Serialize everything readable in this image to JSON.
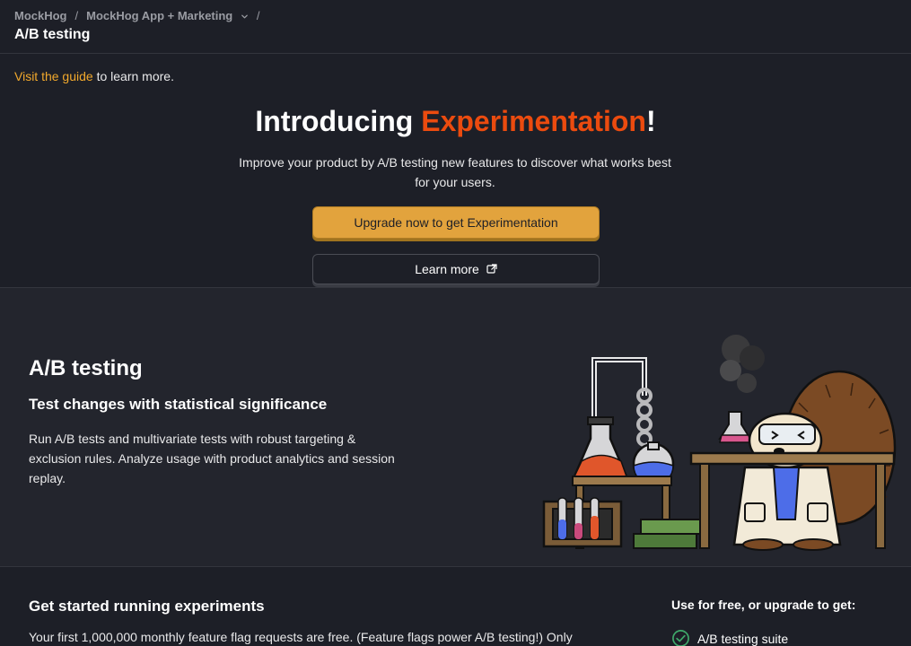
{
  "breadcrumb": {
    "org": "MockHog",
    "project": "MockHog App + Marketing",
    "separator": "/"
  },
  "page": {
    "title": "A/B testing"
  },
  "guide": {
    "link": "Visit the guide",
    "suffix": " to learn more."
  },
  "hero": {
    "title_prefix": "Introducing ",
    "title_accent": "Experimentation",
    "title_suffix": "!",
    "description": "Improve your product by A/B testing new features to discover what works best for your users.",
    "upgrade_button": "Upgrade now to get Experimentation",
    "learn_more_button": "Learn more"
  },
  "feature": {
    "title": "A/B testing",
    "subtitle": "Test changes with statistical significance",
    "description": "Run A/B tests and multivariate tests with robust targeting & exclusion rules. Analyze usage with product analytics and session replay.",
    "illustration_icon": "hedgehog-scientist-lab-illustration"
  },
  "get_started": {
    "title": "Get started running experiments",
    "description": "Your first 1,000,000 monthly feature flag requests are free. (Feature flags power A/B testing!) Only"
  },
  "upgrade_benefits": {
    "heading": "Use for free, or upgrade to get:",
    "items": [
      "A/B testing suite"
    ]
  },
  "colors": {
    "background": "#1d1f27",
    "panel": "#23252d",
    "accent_orange": "#eb4b0f",
    "link_yellow": "#f1a82c",
    "upgrade_button": "#e2a33d",
    "check_green": "#3fa86a"
  },
  "icons": {
    "project_dropdown": "chevron-down-icon",
    "learn_more": "external-link-icon",
    "benefit": "check-circle-icon"
  }
}
